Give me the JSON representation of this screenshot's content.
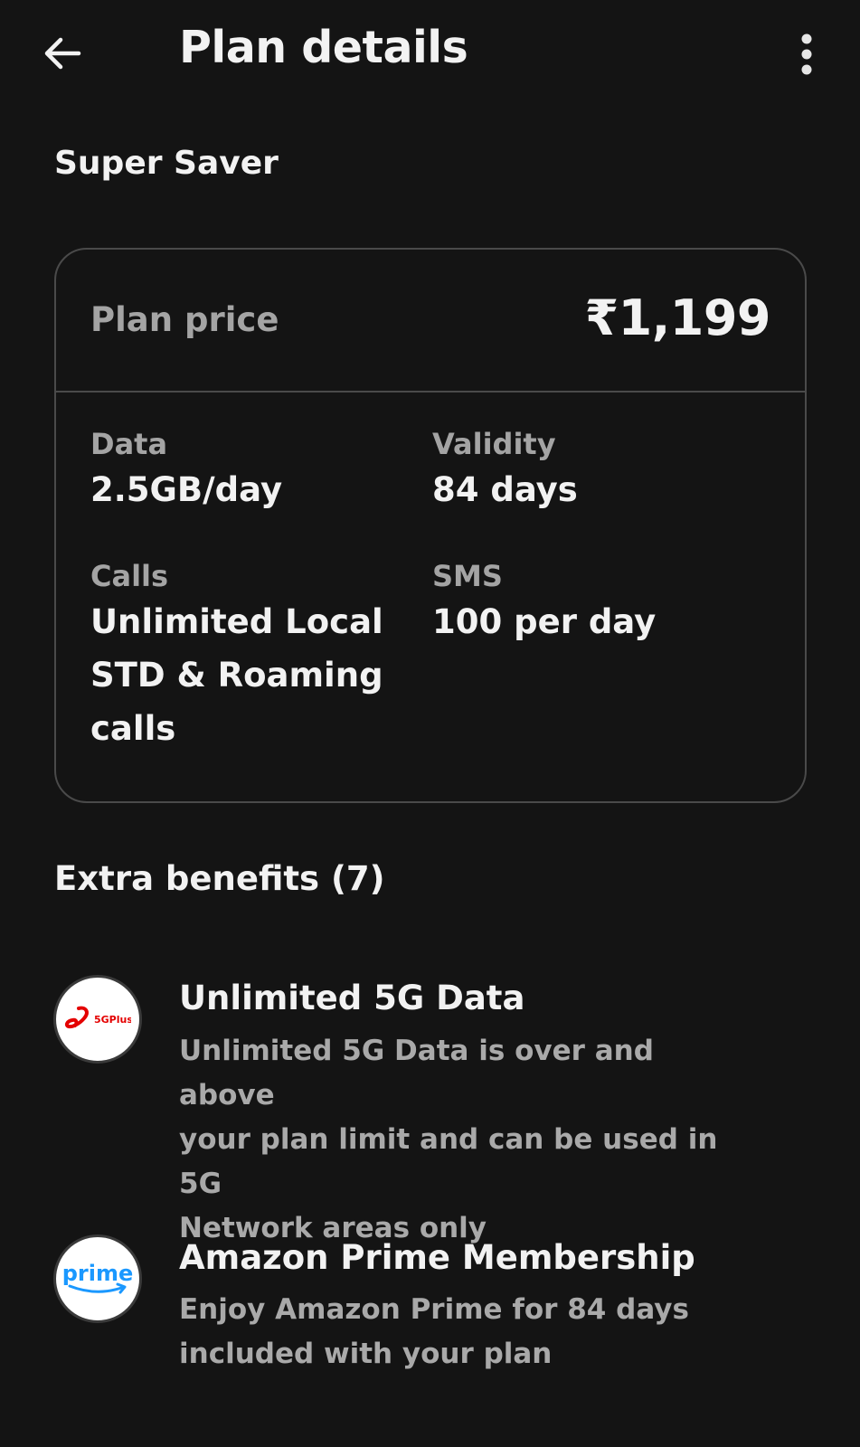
{
  "header": {
    "title": "Plan details",
    "back_icon": "arrow-left-icon",
    "menu_icon": "more-vert-icon"
  },
  "plan": {
    "name": "Super Saver",
    "price_label": "Plan price",
    "price_value": "₹1,199",
    "data_label": "Data",
    "data_value": "2.5GB/day",
    "validity_label": "Validity",
    "validity_value": "84 days",
    "calls_label": "Calls",
    "calls_value_lines": [
      "Unlimited Local",
      "STD & Roaming",
      "calls"
    ],
    "sms_label": "SMS",
    "sms_value": "100 per day"
  },
  "benefits": {
    "title": "Extra benefits (7)",
    "items": [
      {
        "title": "Unlimited 5G Data",
        "description_lines": [
          "Unlimited 5G Data is over and above",
          "your plan limit and can be used in 5G",
          "Network areas only"
        ],
        "logo_icon": "airtel-5gplus-icon",
        "logo_text": "5GPlus"
      },
      {
        "title": "Amazon Prime Membership",
        "description_lines": [
          "Enjoy Amazon Prime for 84 days",
          "included with your plan"
        ],
        "logo_icon": "amazon-prime-icon",
        "logo_text": "prime"
      }
    ]
  },
  "colors": {
    "background": "#141414",
    "text_primary": "#f2f2f2",
    "text_secondary": "#a4a4a4",
    "card_border": "#4a4a4a",
    "airtel_red": "#e40000",
    "prime_blue": "#1a98ff"
  }
}
